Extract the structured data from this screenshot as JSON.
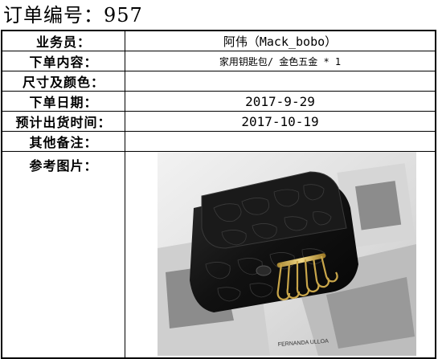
{
  "order": {
    "title": "订单编号：957"
  },
  "fields": {
    "salesperson": {
      "label": "业务员：",
      "value": "阿伟（Mack_bobo）"
    },
    "order_content": {
      "label": "下单内容：",
      "value": "家用钥匙包/ 金色五金 * 1"
    },
    "size_color": {
      "label": "尺寸及颜色：",
      "value": ""
    },
    "order_date": {
      "label": "下单日期：",
      "value": "2017-9-29"
    },
    "ship_date": {
      "label": "预计出货时间：",
      "value": "2017-10-19"
    },
    "notes": {
      "label": "其他备注：",
      "value": ""
    },
    "reference": {
      "label": "参考图片："
    }
  },
  "photo": {
    "brand_text": "FERNANDA ULLOA",
    "subject": "black-croc-key-wallet-with-gold-hooks"
  }
}
